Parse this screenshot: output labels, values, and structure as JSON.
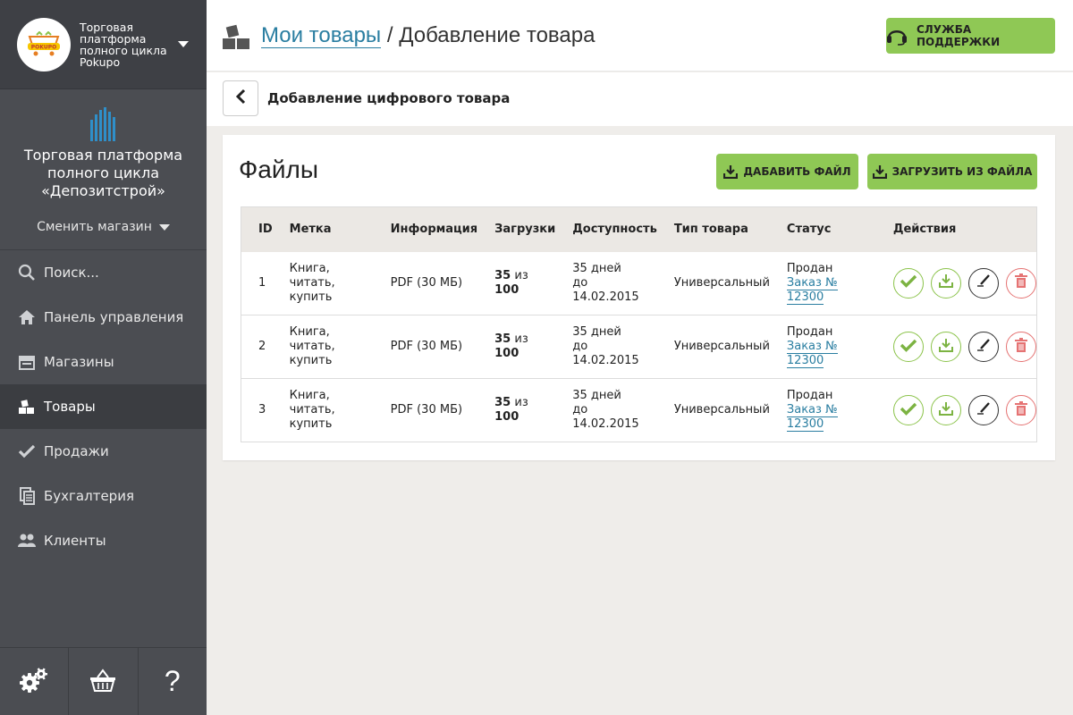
{
  "brand": {
    "title": "Торговая платформа полного цикла Pokupo",
    "logo_text": "POKUPO"
  },
  "store": {
    "name": "Торговая платформа полного цикла «Депозитстрой»",
    "switch_label": "Сменить магазин"
  },
  "nav": [
    {
      "label": "Поиск...",
      "icon": "search-icon"
    },
    {
      "label": "Панель управления",
      "icon": "home-icon"
    },
    {
      "label": "Магазины",
      "icon": "store-icon"
    },
    {
      "label": "Товары",
      "icon": "boxes-icon",
      "active": true
    },
    {
      "label": "Продажи",
      "icon": "check-icon"
    },
    {
      "label": "Бухгалтерия",
      "icon": "documents-icon"
    },
    {
      "label": "Клиенты",
      "icon": "users-icon"
    }
  ],
  "header": {
    "crumb_link": "Мои товары",
    "crumb_sep": " / ",
    "crumb_current": "Добавление товара",
    "support_label": "СЛУЖБА ПОДДЕРЖКИ"
  },
  "subheader": {
    "title": "Добавление цифрового товара"
  },
  "files": {
    "title": "Файлы",
    "add_label": "ДАБАВИТЬ ФАЙЛ",
    "load_label": "ЗАГРУЗИТЬ ИЗ ФАЙЛА",
    "columns": [
      "ID",
      "Метка",
      "Информация",
      "Загрузки",
      "Доступность",
      "Тип товара",
      "Статус",
      "Действия"
    ],
    "rows": [
      {
        "id": "1",
        "label_l1": "Книга, читать,",
        "label_l2": "купить",
        "info": "PDF (30 МБ)",
        "dl_used": "35",
        "dl_of": "из",
        "dl_total": "100",
        "avail_l1": "35 дней",
        "avail_l2": "до 14.02.2015",
        "type": "Универсальный",
        "status": "Продан",
        "order": "Заказ № 12300"
      },
      {
        "id": "2",
        "label_l1": "Книга, читать,",
        "label_l2": "купить",
        "info": "PDF (30 МБ)",
        "dl_used": "35",
        "dl_of": "из",
        "dl_total": "100",
        "avail_l1": "35 дней",
        "avail_l2": "до 14.02.2015",
        "type": "Универсальный",
        "status": "Продан",
        "order": "Заказ № 12300"
      },
      {
        "id": "3",
        "label_l1": "Книга, читать,",
        "label_l2": "купить",
        "info": "PDF (30 МБ)",
        "dl_used": "35",
        "dl_of": "из",
        "dl_total": "100",
        "avail_l1": "35 дней",
        "avail_l2": "до 14.02.2015",
        "type": "Универсальный",
        "status": "Продан",
        "order": "Заказ № 12300"
      }
    ]
  },
  "colors": {
    "accent_green": "#8fc855",
    "link_blue": "#2a7ea1",
    "sidebar_bg": "#4b4d52",
    "delete_red": "#e57373"
  }
}
